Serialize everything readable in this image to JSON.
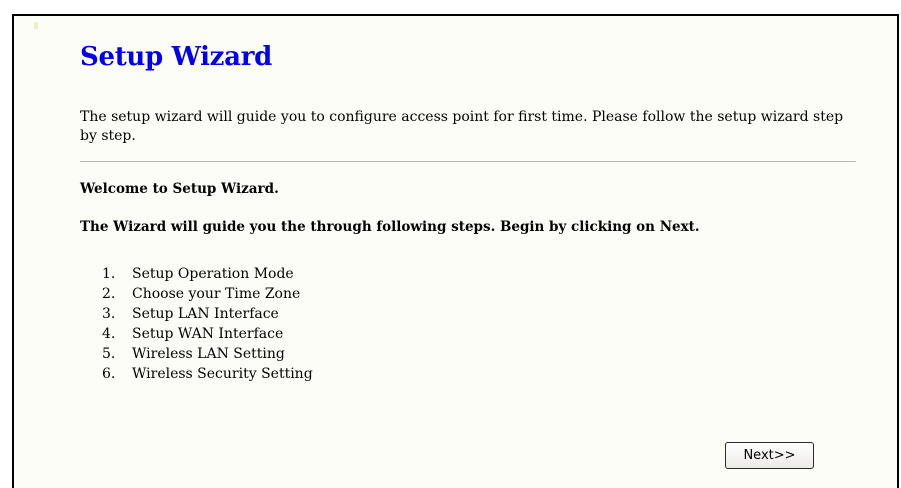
{
  "page": {
    "title": "Setup Wizard",
    "intro": "The setup wizard will guide you to configure access point for first time. Please follow the setup wizard step by step.",
    "welcome": "Welcome to Setup Wizard.",
    "guide": "The Wizard will guide you the through following steps. Begin by clicking on Next."
  },
  "steps": [
    {
      "num": "1.",
      "label": "Setup Operation Mode"
    },
    {
      "num": "2.",
      "label": "Choose your Time Zone"
    },
    {
      "num": "3.",
      "label": "Setup LAN Interface"
    },
    {
      "num": "4.",
      "label": "Setup WAN Interface"
    },
    {
      "num": "5.",
      "label": "Wireless LAN Setting"
    },
    {
      "num": "6.",
      "label": "Wireless Security Setting"
    }
  ],
  "buttons": {
    "next_label": "Next>>"
  },
  "colors": {
    "title": "#0000ee",
    "background": "#fdfdf8",
    "divider": "#b8b8b8"
  }
}
